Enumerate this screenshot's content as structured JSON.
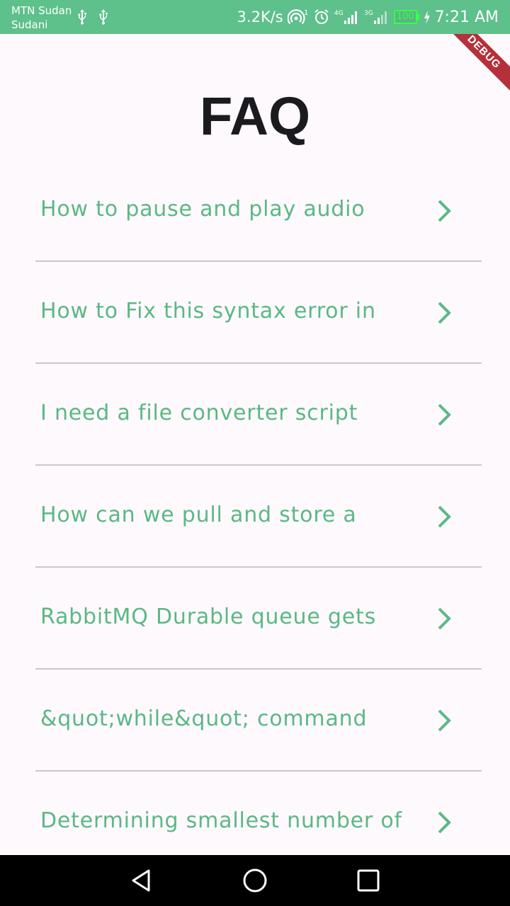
{
  "status_bar": {
    "carrier_line1": "MTN Sudan",
    "carrier_line2": "Sudani",
    "speed": "3.2K/s",
    "hotspot_sup": "1",
    "net1": "4G",
    "net2": "3G",
    "battery": "100",
    "time": "7:21 AM",
    "background": "#5ec08a"
  },
  "debug_banner": {
    "label": "DEBUG"
  },
  "page": {
    "title": "FAQ"
  },
  "faq": {
    "items": [
      {
        "text": "How to pause and play audio"
      },
      {
        "text": "How to Fix this syntax error in"
      },
      {
        "text": "I need a file converter script"
      },
      {
        "text": "How can we pull and store a"
      },
      {
        "text": "RabbitMQ Durable queue gets"
      },
      {
        "text": "&quot;while&quot; command"
      },
      {
        "text": "Determining smallest number of"
      }
    ],
    "accent_color": "#5bb884"
  },
  "nav": {
    "back_icon": "back-triangle-icon",
    "home_icon": "home-circle-icon",
    "recents_icon": "recents-square-icon"
  }
}
